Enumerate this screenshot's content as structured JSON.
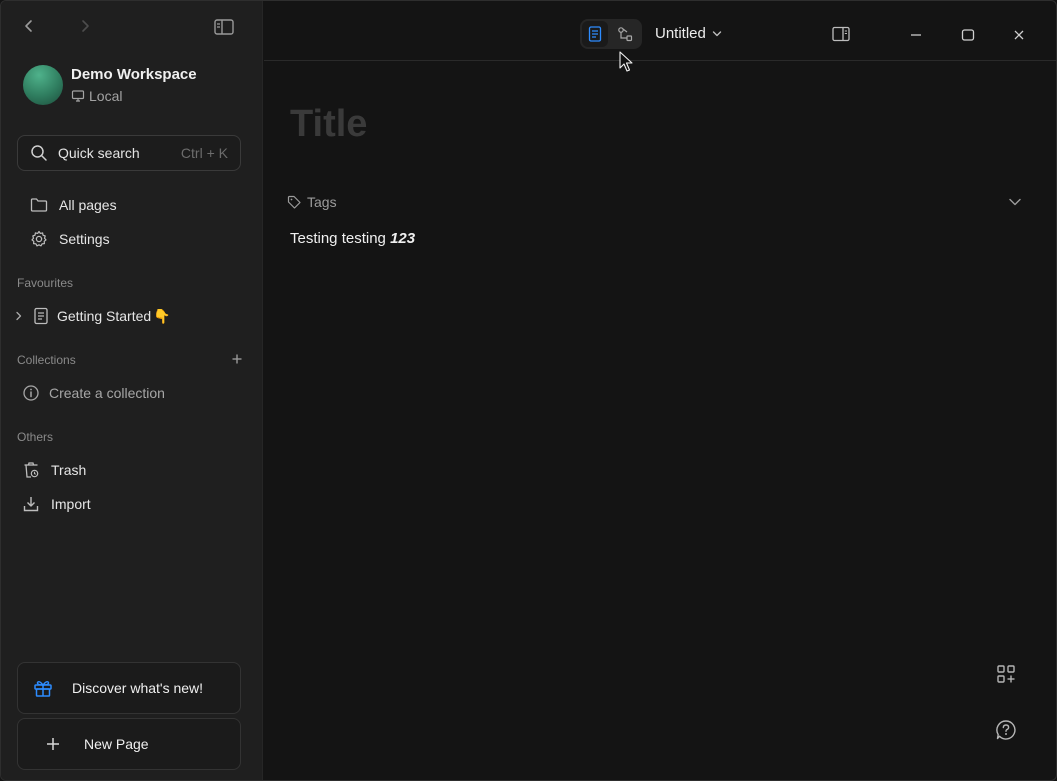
{
  "sidebar": {
    "workspace": {
      "name": "Demo Workspace",
      "storage": "Local"
    },
    "quick_search": {
      "label": "Quick search",
      "shortcut": "Ctrl + K"
    },
    "nav": [
      {
        "label": "All pages",
        "icon": "folder-icon"
      },
      {
        "label": "Settings",
        "icon": "gear-icon"
      }
    ],
    "favourites": {
      "heading": "Favourites",
      "items": [
        {
          "label": "Getting Started",
          "emoji": "👇"
        }
      ]
    },
    "collections": {
      "heading": "Collections",
      "empty_action": "Create a collection"
    },
    "others": {
      "heading": "Others",
      "items": [
        {
          "label": "Trash",
          "icon": "trash-icon"
        },
        {
          "label": "Import",
          "icon": "import-icon"
        }
      ]
    },
    "discover_label": "Discover what's new!",
    "new_page_label": "New Page"
  },
  "topbar": {
    "doc_title": "Untitled",
    "mode_active": "page"
  },
  "editor": {
    "title_placeholder": "Title",
    "tags_label": "Tags",
    "body_text_plain": "Testing testing ",
    "body_text_emph": "123"
  },
  "colors": {
    "accent": "#2d8cff",
    "sidebar_bg": "#1f1f1f",
    "main_bg": "#141414"
  }
}
